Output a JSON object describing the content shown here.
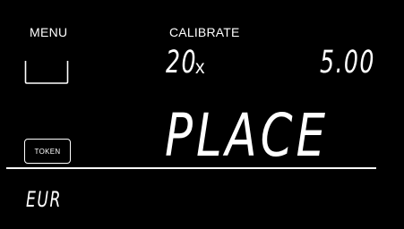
{
  "header": {
    "menu_label": "MENU",
    "mode_label": "CALIBRATE"
  },
  "tray": {
    "icon": "tray-icon"
  },
  "readout": {
    "count_value": "20",
    "count_unit": "x",
    "amount": "5.00"
  },
  "token_button": {
    "label": "TOKEN"
  },
  "message": "PLACE",
  "currency": "EUR"
}
